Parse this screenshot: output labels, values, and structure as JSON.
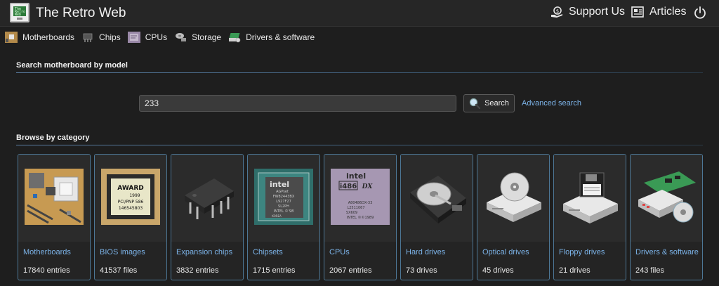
{
  "header": {
    "site_title": "The Retro Web",
    "logo_text": "The Retro Web",
    "support_label": "Support Us",
    "articles_label": "Articles",
    "logo_icon": "retro-computer-logo-icon",
    "support_icon": "support-money-icon",
    "articles_icon": "articles-newspaper-icon",
    "power_icon": "power-icon"
  },
  "nav": {
    "items": [
      {
        "label": "Motherboards",
        "icon": "motherboard-icon"
      },
      {
        "label": "Chips",
        "icon": "chip-icon"
      },
      {
        "label": "CPUs",
        "icon": "cpu-icon"
      },
      {
        "label": "Storage",
        "icon": "storage-icon"
      },
      {
        "label": "Drivers & software",
        "icon": "drivers-software-icon"
      }
    ]
  },
  "search": {
    "section_title": "Search motherboard by model",
    "value": "233",
    "button_label": "Search",
    "advanced_label": "Advanced search",
    "icon": "magnifier-icon"
  },
  "browse": {
    "section_title": "Browse by category",
    "categories": [
      {
        "name": "Motherboards",
        "count": "17840 entries",
        "icon": "motherboard-image"
      },
      {
        "name": "BIOS images",
        "count": "41537 files",
        "icon": "bios-chip-image",
        "chip_text": [
          "AWARD",
          "1999",
          "PCI/PNP 586",
          "146545803"
        ]
      },
      {
        "name": "Expansion chips",
        "count": "3832 entries",
        "icon": "dip-chip-image"
      },
      {
        "name": "Chipsets",
        "count": "1715 entries",
        "icon": "intel-chipset-image",
        "chip_text": [
          "intel",
          "AGPset",
          "FW82443BX",
          "L927F27",
          "SL2PH",
          "INTEL ©'98",
          "KOREA"
        ]
      },
      {
        "name": "CPUs",
        "count": "2067 entries",
        "icon": "intel-486-cpu-image",
        "chip_text": [
          "intel",
          "i486",
          "DX",
          "A80486DX-33",
          "L2511067",
          "SX609",
          "INTEL ©©1989"
        ]
      },
      {
        "name": "Hard drives",
        "count": "73 drives",
        "icon": "hard-drive-image"
      },
      {
        "name": "Optical drives",
        "count": "45 drives",
        "icon": "optical-drive-image"
      },
      {
        "name": "Floppy drives",
        "count": "21 drives",
        "icon": "floppy-drive-image"
      },
      {
        "name": "Drivers & software",
        "count": "243 files",
        "icon": "expansion-card-cd-image"
      }
    ]
  },
  "colors": {
    "background": "#1e1e1e",
    "accent_link": "#7cb3e8",
    "card_border": "#4d7796"
  }
}
